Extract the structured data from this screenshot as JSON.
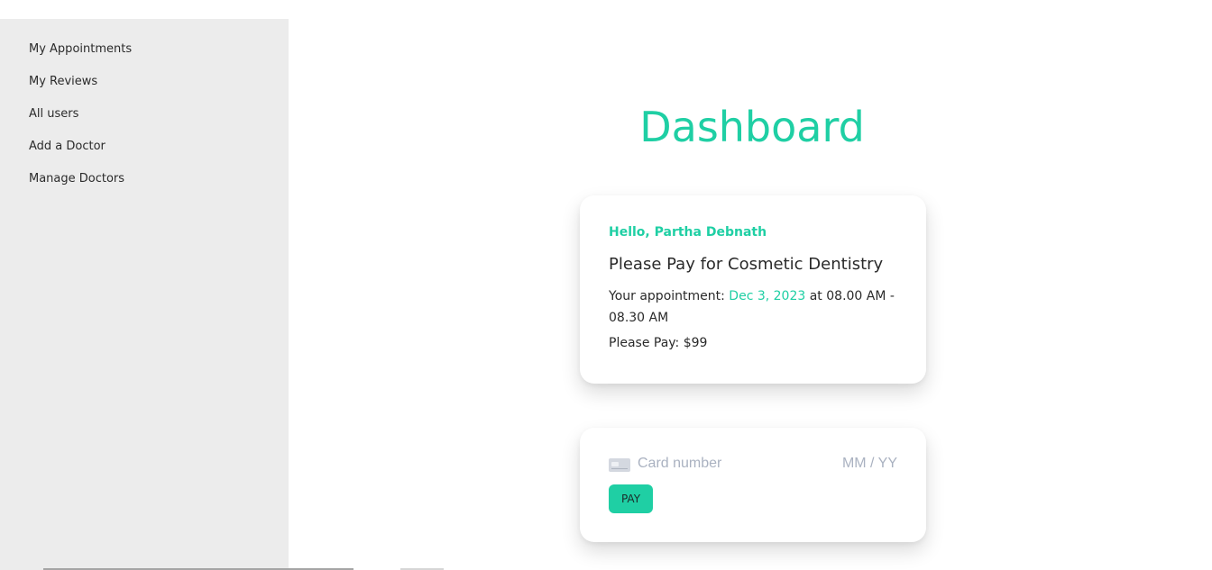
{
  "sidebar": {
    "items": [
      {
        "label": "My Appointments"
      },
      {
        "label": "My Reviews"
      },
      {
        "label": "All users"
      },
      {
        "label": "Add a Doctor"
      },
      {
        "label": "Manage Doctors"
      }
    ]
  },
  "main": {
    "title": "Dashboard",
    "appointment": {
      "greeting": "Hello, Partha Debnath",
      "heading": "Please Pay for Cosmetic Dentistry",
      "appointment_prefix": "Your appointment: ",
      "date": "Dec 3, 2023",
      "time_text": " at 08.00 AM - 08.30 AM",
      "pay_text": "Please Pay: $99"
    },
    "payment": {
      "card_icon": "credit-card-icon",
      "card_number_placeholder": "Card number",
      "expiry_placeholder": "MM / YY",
      "pay_label": "PAY"
    }
  },
  "colors": {
    "accent": "#1fcfa4",
    "sidebar_bg": "#ececec",
    "placeholder": "#aab2c1"
  }
}
